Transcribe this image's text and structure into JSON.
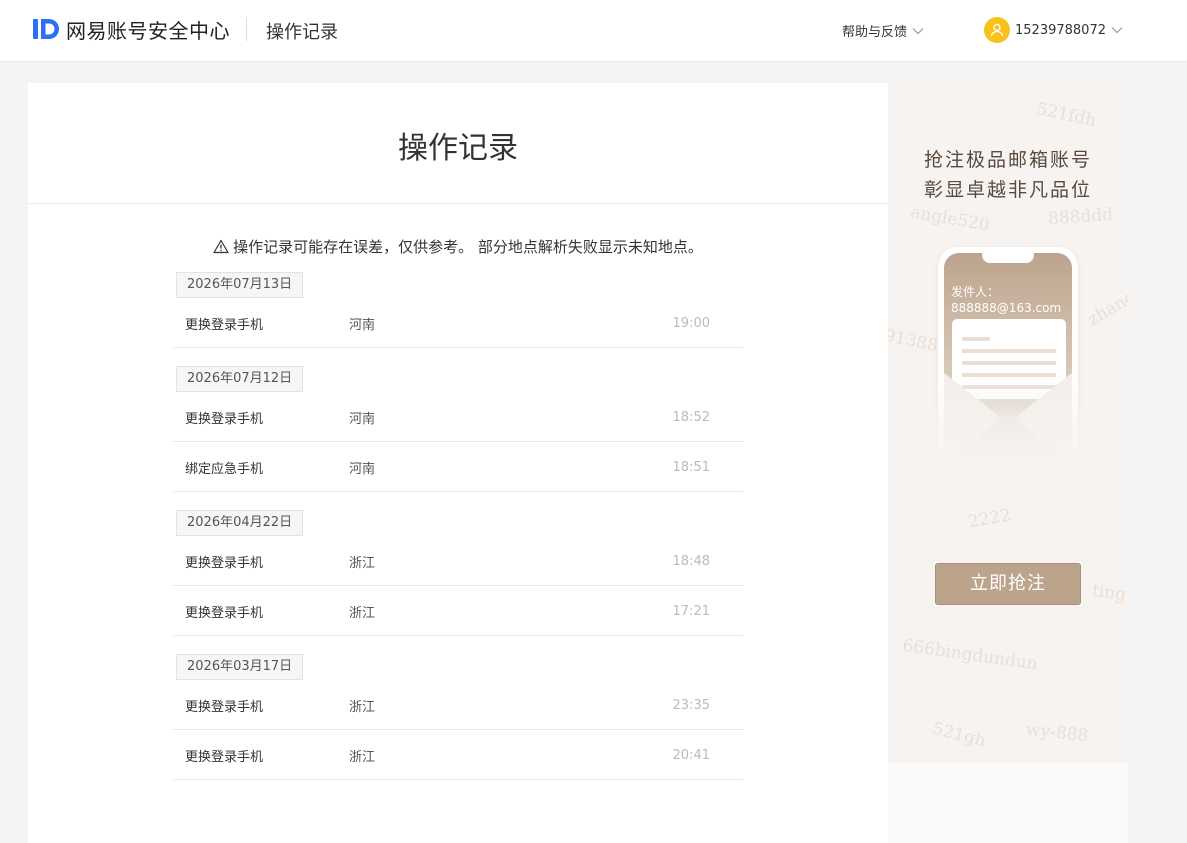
{
  "header": {
    "logo_text": "网易账号安全中心",
    "page_name": "操作记录",
    "help_label": "帮助与反馈",
    "user_phone": "15239788072"
  },
  "main": {
    "title": "操作记录",
    "notice": "操作记录可能存在误差，仅供参考。 部分地点解析失败显示未知地点。",
    "groups": [
      {
        "date": "2026年07月13日",
        "records": [
          {
            "action": "更换登录手机",
            "place": "河南",
            "time": "19:00"
          }
        ]
      },
      {
        "date": "2026年07月12日",
        "records": [
          {
            "action": "更换登录手机",
            "place": "河南",
            "time": "18:52"
          },
          {
            "action": "绑定应急手机",
            "place": "河南",
            "time": "18:51"
          }
        ]
      },
      {
        "date": "2026年04月22日",
        "records": [
          {
            "action": "更换登录手机",
            "place": "浙江",
            "time": "18:48"
          },
          {
            "action": "更换登录手机",
            "place": "浙江",
            "time": "17:21"
          }
        ]
      },
      {
        "date": "2026年03月17日",
        "records": [
          {
            "action": "更换登录手机",
            "place": "浙江",
            "time": "23:35"
          },
          {
            "action": "更换登录手机",
            "place": "浙江",
            "time": "20:41"
          }
        ]
      }
    ]
  },
  "ad": {
    "line1": "抢注极品邮箱账号",
    "line2": "彰显卓越非凡品位",
    "sender_label": "发件人：",
    "sender_mail": "888888@163.com",
    "button_label": "立即抢注",
    "watermarks": [
      "521fdh",
      "angle520",
      "888ddd",
      "91388",
      "zhangsan",
      "2222",
      "ting",
      "666bingdundun",
      "521gh",
      "wy-888"
    ]
  },
  "colors": {
    "brand_blue": "#2b6ff6",
    "avatar_yellow": "#f8c21a",
    "ad_button": "#bba48b"
  },
  "icons": {
    "logo": "netease-id-logo",
    "help_chevron": "chevron-down-icon",
    "avatar": "user-avatar-icon",
    "notice": "warning-icon"
  }
}
